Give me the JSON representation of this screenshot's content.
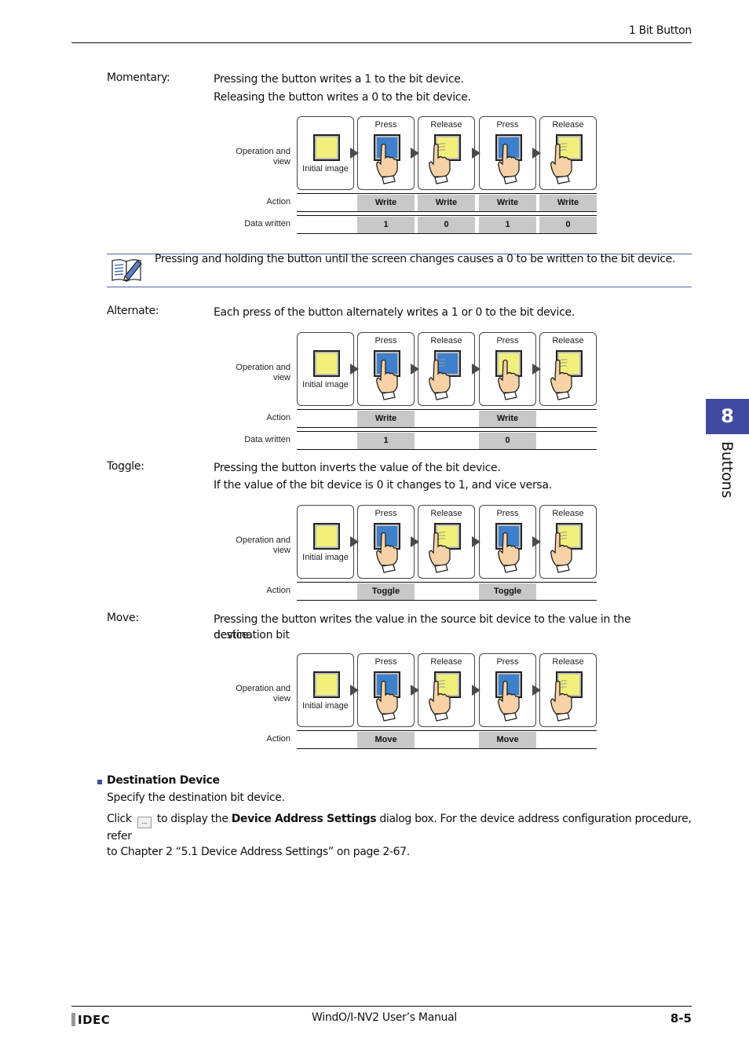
{
  "header": {
    "section_title": "1 Bit Button"
  },
  "momentary": {
    "term": "Momentary:",
    "lines": [
      "Pressing the button writes a 1 to the bit device.",
      "Releasing the button writes a 0 to the bit device."
    ]
  },
  "note": {
    "icon": "notebook-pencil-icon",
    "text": "Pressing and holding the button until the screen changes causes a 0 to be written to the bit device."
  },
  "alternate": {
    "term": "Alternate:",
    "lines": [
      "Each press of the button alternately writes a 1 or 0 to the bit device."
    ]
  },
  "toggle": {
    "term": "Toggle:",
    "lines": [
      "Pressing the button inverts the value of the bit device.",
      "If the value of the bit device is 0 it changes to 1, and vice versa."
    ]
  },
  "move": {
    "term": "Move:",
    "lines": [
      "Pressing the button writes the value in the source bit device to the value in the destination bit",
      "device."
    ]
  },
  "diagram_labels": {
    "operation_and_view": [
      "Operation and",
      "view"
    ],
    "action": "Action",
    "data_written": "Data written",
    "initial_image": "Initial image",
    "press": "Press",
    "release": "Release"
  },
  "diagrams": [
    {
      "id": "momentary",
      "states": [
        "yellow",
        "blue",
        "yellow",
        "blue",
        "yellow"
      ],
      "steps": [
        "Press",
        "Release",
        "Press",
        "Release"
      ],
      "actions": [
        "Write",
        "Write",
        "Write",
        "Write"
      ],
      "data_written": [
        "1",
        "0",
        "1",
        "0"
      ]
    },
    {
      "id": "alternate",
      "states": [
        "yellow",
        "blue",
        "blue",
        "yellow",
        "yellow"
      ],
      "steps": [
        "Press",
        "Release",
        "Press",
        "Release"
      ],
      "actions": [
        "Write",
        "",
        "Write",
        ""
      ],
      "data_written": [
        "1",
        "",
        "0",
        ""
      ]
    },
    {
      "id": "toggle",
      "states": [
        "yellow",
        "blue",
        "yellow",
        "blue",
        "yellow"
      ],
      "steps": [
        "Press",
        "Release",
        "Press",
        "Release"
      ],
      "actions": [
        "Toggle",
        "",
        "Toggle",
        ""
      ]
    },
    {
      "id": "move",
      "states": [
        "yellow",
        "blue",
        "yellow",
        "blue",
        "yellow"
      ],
      "steps": [
        "Press",
        "Release",
        "Press",
        "Release"
      ],
      "actions": [
        "Move",
        "",
        "Move",
        ""
      ]
    }
  ],
  "destination": {
    "title": "Destination Device",
    "line1": "Specify the destination bit device.",
    "click": "Click",
    "browse_button": "...",
    "to_display": "to display the",
    "dialog_name": "Device Address Settings",
    "rest": "dialog box. For the device address configuration procedure, refer",
    "line3": "to Chapter 2 “5.1 Device Address Settings” on page 2-67."
  },
  "side_tab": {
    "number": "8",
    "label": "Buttons",
    "color": "#3f4aa0"
  },
  "footer": {
    "logo": "IDEC",
    "manual": "WindO/I-NV2 User’s Manual",
    "page": "8-5"
  }
}
